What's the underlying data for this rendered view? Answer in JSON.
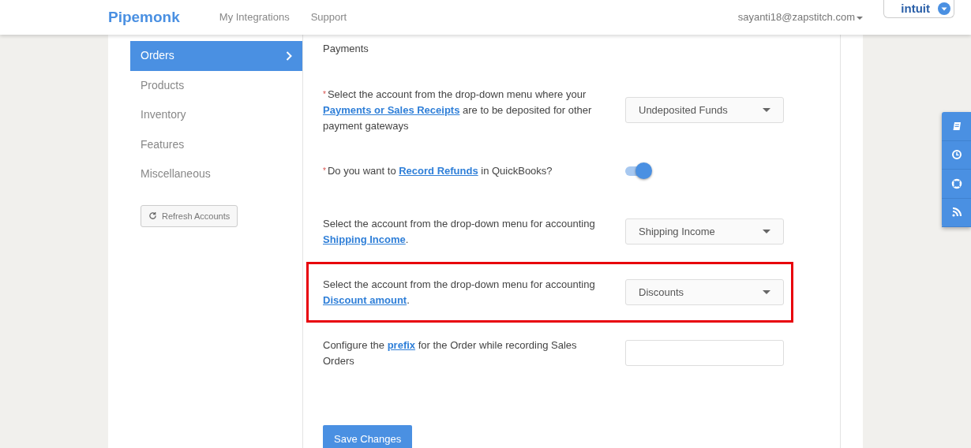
{
  "header": {
    "logo": "Pipemonk",
    "nav": [
      {
        "label": "My Integrations"
      },
      {
        "label": "Support"
      }
    ],
    "user_email": "sayanti18@zapstitch.com",
    "badge": "intuit"
  },
  "sidebar": {
    "items": [
      {
        "label": "Orders",
        "selected": true
      },
      {
        "label": "Products",
        "selected": false
      },
      {
        "label": "Inventory",
        "selected": false
      },
      {
        "label": "Features",
        "selected": false
      },
      {
        "label": "Miscellaneous",
        "selected": false
      }
    ],
    "refresh_button": "Refresh Accounts"
  },
  "settings": [
    {
      "kind": "none",
      "highlighted": false,
      "label": [
        {
          "text": "Payments"
        }
      ]
    },
    {
      "kind": "select",
      "highlighted": false,
      "required_mark": "*",
      "label": [
        {
          "text": "Select the account from the drop-down menu where your "
        },
        {
          "link": "Payments or Sales Receipts"
        },
        {
          "text": " are to be deposited for other payment gateways"
        }
      ],
      "value": "Undeposited Funds"
    },
    {
      "kind": "toggle",
      "highlighted": false,
      "required_mark": "*",
      "label": [
        {
          "text": "Do you want to "
        },
        {
          "link": "Record Refunds"
        },
        {
          "text": " in QuickBooks?"
        }
      ],
      "on": true
    },
    {
      "kind": "select",
      "highlighted": false,
      "label": [
        {
          "text": "Select the account from the drop-down menu for accounting "
        },
        {
          "link": "Shipping Income"
        },
        {
          "text": "."
        }
      ],
      "value": "Shipping Income"
    },
    {
      "kind": "select",
      "highlighted": true,
      "label": [
        {
          "text": "Select the account from the drop-down menu for accounting "
        },
        {
          "link": "Discount amount"
        },
        {
          "text": "."
        }
      ],
      "value": "Discounts"
    },
    {
      "kind": "input",
      "highlighted": false,
      "label": [
        {
          "text": "Configure the "
        },
        {
          "link": "prefix"
        },
        {
          "text": " for the Order while recording Sales Orders"
        }
      ]
    }
  ],
  "save_button": "Save Changes"
}
